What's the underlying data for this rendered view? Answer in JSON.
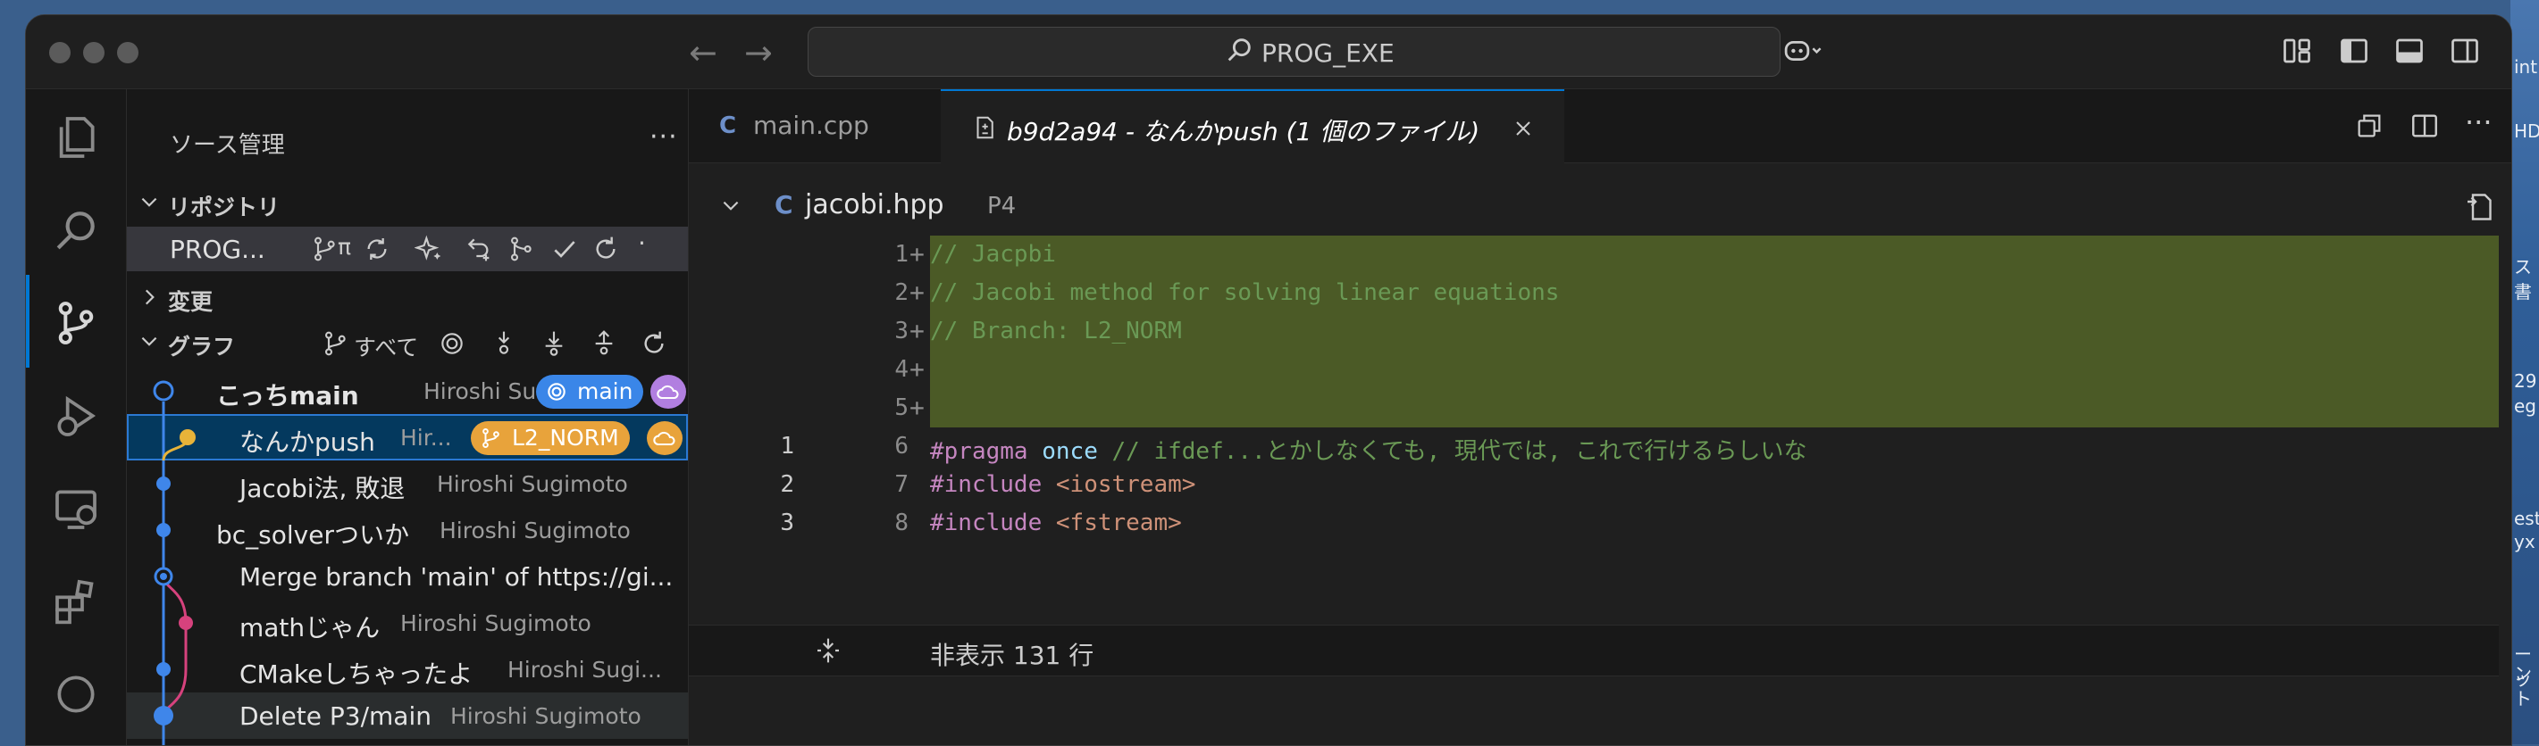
{
  "titlebar": {
    "search_text": "PROG_EXE"
  },
  "desktop_fragments": [
    "int",
    "HD",
    "ス",
    "書",
    "29",
    "eg",
    "est",
    "yx",
    "ーン",
    "ット"
  ],
  "sidebar": {
    "title": "ソース管理",
    "more": "···",
    "sections": {
      "repositories": "リポジトリ",
      "changes": "変更",
      "graph": "グラフ"
    },
    "repo_name": "PROG...",
    "repo_branch_label": "π",
    "graph_filter": "すべて",
    "graph_rows": [
      {
        "message": "こっちmain",
        "author": "Hiroshi Su...",
        "badge": "main",
        "bold": true
      },
      {
        "message": "なんかpush",
        "author": "Hir...",
        "badge": "L2_NORM"
      },
      {
        "message": "Jacobi法, 敗退",
        "author": "Hiroshi Sugimoto"
      },
      {
        "message": "bc_solverついか",
        "author": "Hiroshi Sugimoto"
      },
      {
        "message": "Merge branch 'main' of https://gi...",
        "author": ""
      },
      {
        "message": "mathじゃん",
        "author": "Hiroshi Sugimoto"
      },
      {
        "message": "CMakeしちゃったよ",
        "author": "Hiroshi Sugi..."
      },
      {
        "message": "Delete P3/main",
        "author": "Hiroshi Sugimoto"
      }
    ]
  },
  "editor": {
    "tabs": [
      {
        "label": "main.cpp"
      },
      {
        "label": "b9d2a94 - なんかpush (1 個のファイル)"
      }
    ],
    "file_header": {
      "name": "jacobi.hpp",
      "path": "P4"
    },
    "lines": [
      {
        "old": "",
        "new": "1",
        "marker": "+",
        "added": true,
        "segments": [
          {
            "t": "// Jacpbi",
            "c": "comment"
          }
        ]
      },
      {
        "old": "",
        "new": "2",
        "marker": "+",
        "added": true,
        "segments": [
          {
            "t": "// Jacobi method for solving linear equations",
            "c": "comment"
          }
        ]
      },
      {
        "old": "",
        "new": "3",
        "marker": "+",
        "added": true,
        "segments": [
          {
            "t": "// Branch: L2_NORM",
            "c": "comment"
          }
        ]
      },
      {
        "old": "",
        "new": "4",
        "marker": "+",
        "added": true,
        "segments": []
      },
      {
        "old": "",
        "new": "5",
        "marker": "+",
        "added": true,
        "segments": []
      },
      {
        "old": "1",
        "new": "6",
        "marker": "",
        "added": false,
        "segments": [
          {
            "t": "#pragma ",
            "c": "pragma"
          },
          {
            "t": "once ",
            "c": "keyword"
          },
          {
            "t": "// ifdef...とかしなくても, 現代では, これで行けるらしいな",
            "c": "comment"
          }
        ]
      },
      {
        "old": "2",
        "new": "7",
        "marker": "",
        "added": false,
        "segments": [
          {
            "t": "#include ",
            "c": "pragma"
          },
          {
            "t": "<iostream>",
            "c": "string"
          }
        ]
      },
      {
        "old": "3",
        "new": "8",
        "marker": "",
        "added": false,
        "segments": [
          {
            "t": "#include ",
            "c": "pragma"
          },
          {
            "t": "<fstream>",
            "c": "string"
          }
        ]
      }
    ],
    "hidden_lines_text": "非表示 131 行"
  },
  "colors": {
    "accent": "#0078d4",
    "added_line": "#4b5a26",
    "badge_main": "#3a86e8",
    "badge_branch": "#e8a33b",
    "cloud_main": "#b17fe0",
    "graph_blue": "#3f86ea",
    "graph_yellow": "#e8b339",
    "graph_pink": "#d6427d"
  }
}
